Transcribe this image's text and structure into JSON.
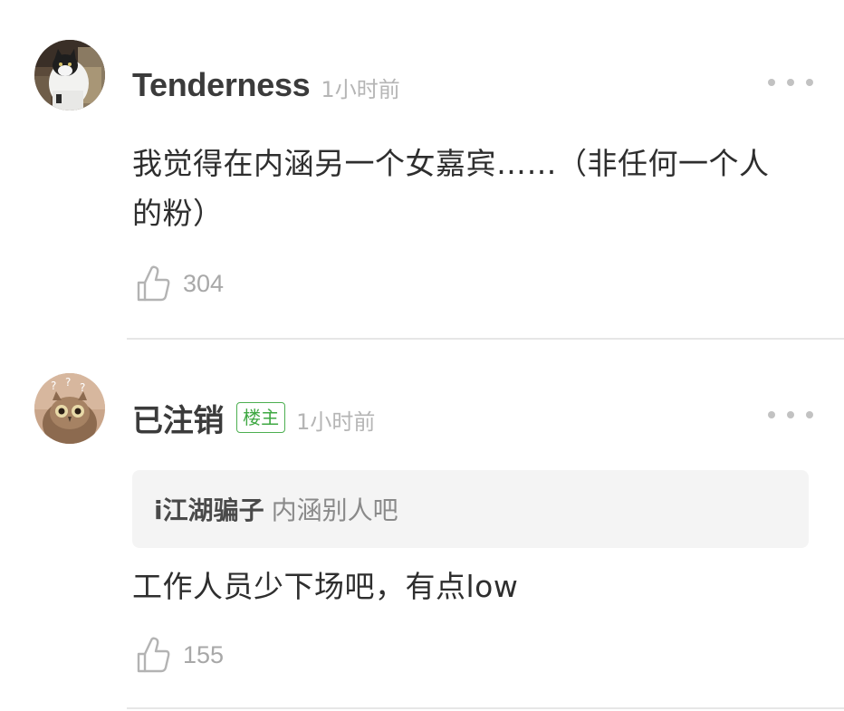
{
  "comments": [
    {
      "username": "Tenderness",
      "timestamp": "1小时前",
      "body": "我觉得在内涵另一个女嘉宾……（非任何一个人的粉）",
      "likes": "304",
      "avatar_icon": "cat-photo-avatar"
    },
    {
      "username": "已注销",
      "badge": "楼主",
      "timestamp": "1小时前",
      "quote": {
        "username": "i江湖骗子",
        "text": "内涵别人吧"
      },
      "body": "工作人员少下场吧，有点low",
      "likes": "155",
      "avatar_icon": "owl-photo-avatar"
    }
  ],
  "icons": {
    "like": "thumbs-up-icon",
    "more": "more-dots-icon"
  },
  "colors": {
    "badge_green": "#3fa843",
    "meta_gray": "#b5b5b5",
    "quote_bg": "#f4f4f4",
    "divider": "#e6e6e6"
  }
}
